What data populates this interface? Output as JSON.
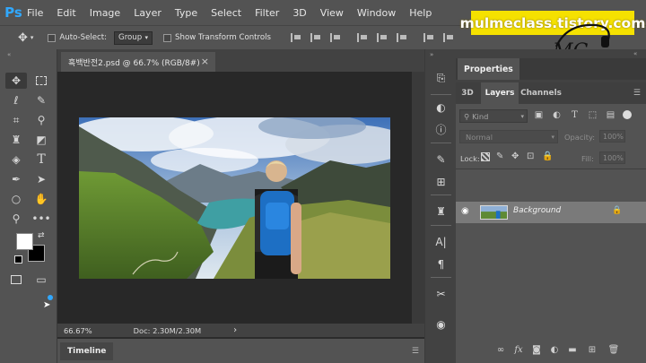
{
  "app": {
    "logo": "Ps"
  },
  "menu": [
    "File",
    "Edit",
    "Image",
    "Layer",
    "Type",
    "Select",
    "Filter",
    "3D",
    "View",
    "Window",
    "Help"
  ],
  "options": {
    "auto_select_label": "Auto-Select:",
    "auto_select_value": "Group",
    "show_transform_label": "Show Transform Controls"
  },
  "watermark": {
    "text": "mulmeclass.tistory.com",
    "logo_text": "MC"
  },
  "document": {
    "tab_title": "흑백반전2.psd @ 66.7% (RGB/8#)",
    "close_glyph": "×",
    "zoom": "66.67%",
    "doc_info": "Doc: 2.30M/2.30M",
    "status_arrow": "›"
  },
  "timeline": {
    "label": "Timeline"
  },
  "properties": {
    "label": "Properties"
  },
  "layers_panel": {
    "tabs": [
      "3D",
      "Layers",
      "Channels"
    ],
    "filter_label": "Kind",
    "blend_mode": "Normal",
    "opacity_label": "Opacity:",
    "opacity_value": "100%",
    "lock_label": "Lock:",
    "fill_label": "Fill:",
    "fill_value": "100%",
    "layer_name": "Background"
  },
  "colors": {
    "chrome": "#535353",
    "canvas_bg": "#282828",
    "ps_blue": "#31a8ff",
    "watermark_yellow": "#f5e100",
    "selected_layer": "#7a7a7a"
  }
}
